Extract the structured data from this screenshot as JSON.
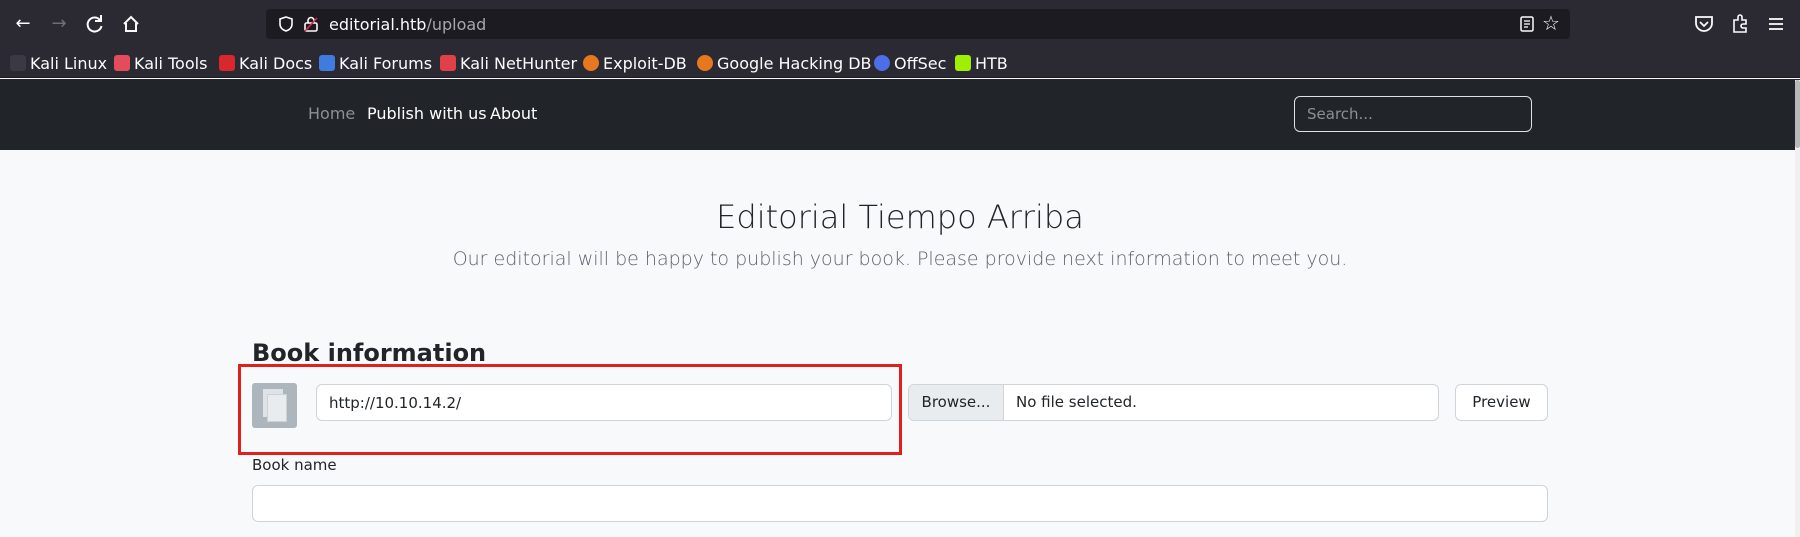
{
  "browser": {
    "url_host": "editorial.htb",
    "url_path": "/upload",
    "bookmarks": [
      {
        "label": "Kali Linux",
        "icon": "kali-dragon-icon",
        "color": "#cfd3e6"
      },
      {
        "label": "Kali Tools",
        "icon": "kali-tools-icon",
        "color": "#e24c5b"
      },
      {
        "label": "Kali Docs",
        "icon": "kali-docs-icon",
        "color": "#d9272e"
      },
      {
        "label": "Kali Forums",
        "icon": "kali-forums-icon",
        "color": "#3f7ce0"
      },
      {
        "label": "Kali NetHunter",
        "icon": "kali-nethunter-icon",
        "color": "#e0404a"
      },
      {
        "label": "Exploit-DB",
        "icon": "exploit-db-icon",
        "color": "#e8781f"
      },
      {
        "label": "Google Hacking DB",
        "icon": "ghdb-icon",
        "color": "#e8781f"
      },
      {
        "label": "OffSec",
        "icon": "offsec-icon",
        "color": "#4d6ee6"
      },
      {
        "label": "HTB",
        "icon": "htb-cube-icon",
        "color": "#9fef00"
      }
    ]
  },
  "navbar": {
    "home": "Home",
    "publish": "Publish with us",
    "about": "About",
    "search_placeholder": "Search..."
  },
  "main": {
    "title": "Editorial Tiempo Arriba",
    "subtitle": "Our editorial will be happy to publish your book. Please provide next information to meet you.",
    "section_title": "Book information",
    "cover_url_value": "http://10.10.14.2/",
    "browse_label": "Browse...",
    "file_status": "No file selected.",
    "preview_label": "Preview",
    "book_name_label": "Book name",
    "book_name_value": ""
  },
  "colors": {
    "highlight": "#e0201c",
    "navbar_bg": "#212529"
  }
}
